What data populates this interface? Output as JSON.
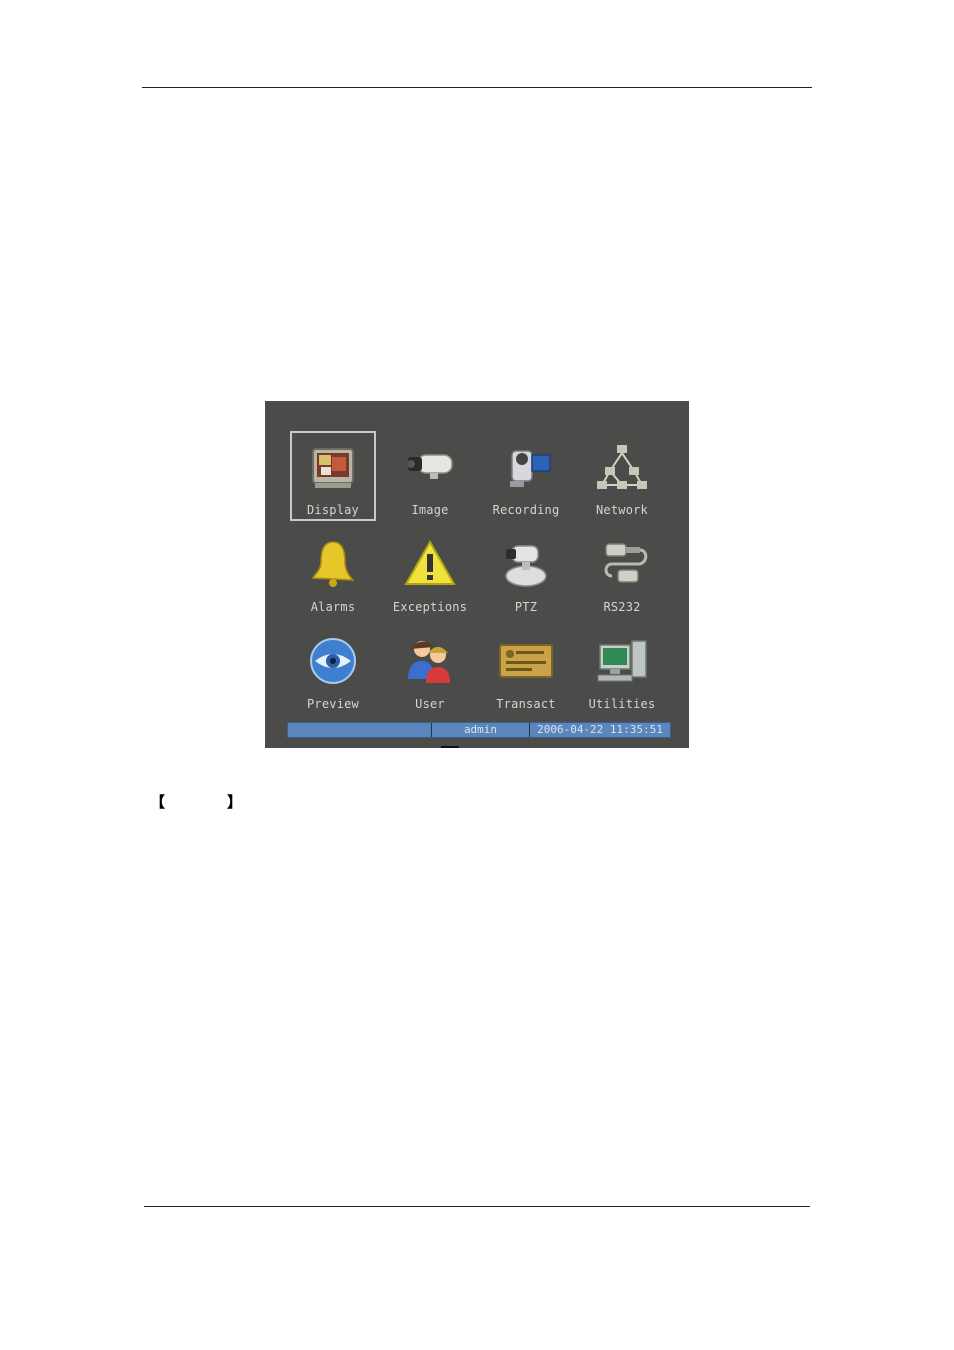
{
  "menu": {
    "items": [
      {
        "label": "Display",
        "icon": "monitor-icon",
        "selected": true
      },
      {
        "label": "Image",
        "icon": "camera-icon"
      },
      {
        "label": "Recording",
        "icon": "camcorder-icon"
      },
      {
        "label": "Network",
        "icon": "network-icon"
      },
      {
        "label": "Alarms",
        "icon": "bell-icon"
      },
      {
        "label": "Exceptions",
        "icon": "warning-icon"
      },
      {
        "label": "PTZ",
        "icon": "ptz-camera-icon"
      },
      {
        "label": "RS232",
        "icon": "serial-connector-icon"
      },
      {
        "label": "Preview",
        "icon": "eye-icon"
      },
      {
        "label": "User",
        "icon": "users-icon"
      },
      {
        "label": "Transact",
        "icon": "card-icon"
      },
      {
        "label": "Utilities",
        "icon": "computer-icon"
      }
    ]
  },
  "status_bar": {
    "user": "admin",
    "datetime": "2006-04-22 11:35:51"
  },
  "caption": {
    "open_bracket": "【",
    "close_bracket": "】"
  }
}
